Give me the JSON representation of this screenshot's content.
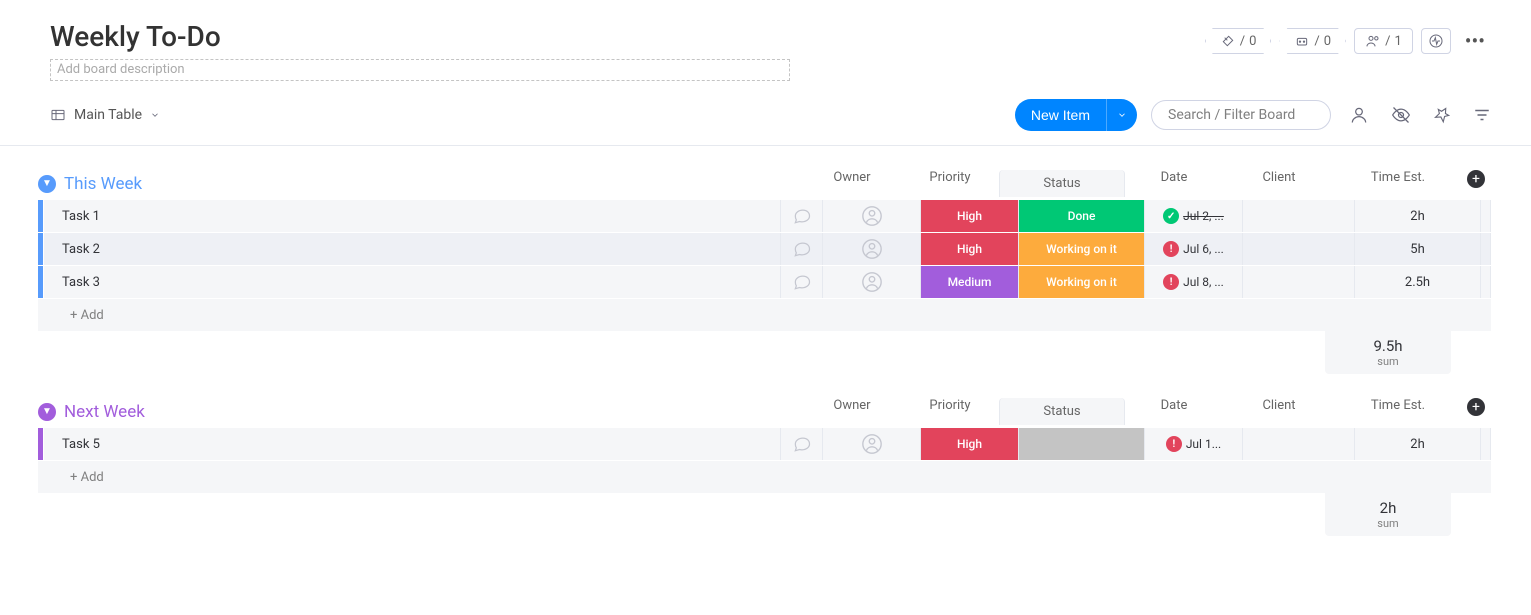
{
  "board": {
    "title": "Weekly To-Do",
    "description_placeholder": "Add board description"
  },
  "header_counters": {
    "integrations": "0",
    "automations": "0",
    "members": "1"
  },
  "view": {
    "name": "Main Table"
  },
  "actions": {
    "new_item": "New Item",
    "search_placeholder": "Search / Filter Board",
    "add_row": "+ Add"
  },
  "columns": {
    "owner": "Owner",
    "priority": "Priority",
    "status": "Status",
    "date": "Date",
    "client": "Client",
    "time": "Time Est."
  },
  "colors": {
    "blue_accent": "#579bfc",
    "purple_accent": "#a25ddc",
    "priority_high": "#e2445c",
    "priority_medium": "#a25ddc",
    "status_done": "#00c875",
    "status_working": "#fdab3d",
    "status_none": "#c4c4c4",
    "date_done": "#00c875",
    "date_overdue": "#e2445c",
    "blue_button": "#0085ff"
  },
  "groups": [
    {
      "id": "this_week",
      "title": "This Week",
      "color_key": "blue_accent",
      "rows": [
        {
          "name": "Task 1",
          "priority": "High",
          "priority_color": "priority_high",
          "status": "Done",
          "status_color": "status_done",
          "date_text": "Jul 2, ...",
          "date_strike": true,
          "date_badge_color": "date_done",
          "date_badge_glyph": "✓",
          "time": "2h"
        },
        {
          "name": "Task 2",
          "priority": "High",
          "priority_color": "priority_high",
          "status": "Working on it",
          "status_color": "status_working",
          "date_text": "Jul 6, ...",
          "date_strike": false,
          "date_badge_color": "date_overdue",
          "date_badge_glyph": "!",
          "time": "5h"
        },
        {
          "name": "Task 3",
          "priority": "Medium",
          "priority_color": "priority_medium",
          "status": "Working on it",
          "status_color": "status_working",
          "date_text": "Jul 8, ...",
          "date_strike": false,
          "date_badge_color": "date_overdue",
          "date_badge_glyph": "!",
          "time": "2.5h"
        }
      ],
      "sum": {
        "value": "9.5h",
        "label": "sum"
      }
    },
    {
      "id": "next_week",
      "title": "Next Week",
      "color_key": "purple_accent",
      "rows": [
        {
          "name": "Task 5",
          "priority": "High",
          "priority_color": "priority_high",
          "status": "",
          "status_color": "status_none",
          "date_text": "Jul 1...",
          "date_strike": false,
          "date_badge_color": "date_overdue",
          "date_badge_glyph": "!",
          "time": "2h"
        }
      ],
      "sum": {
        "value": "2h",
        "label": "sum"
      }
    }
  ]
}
